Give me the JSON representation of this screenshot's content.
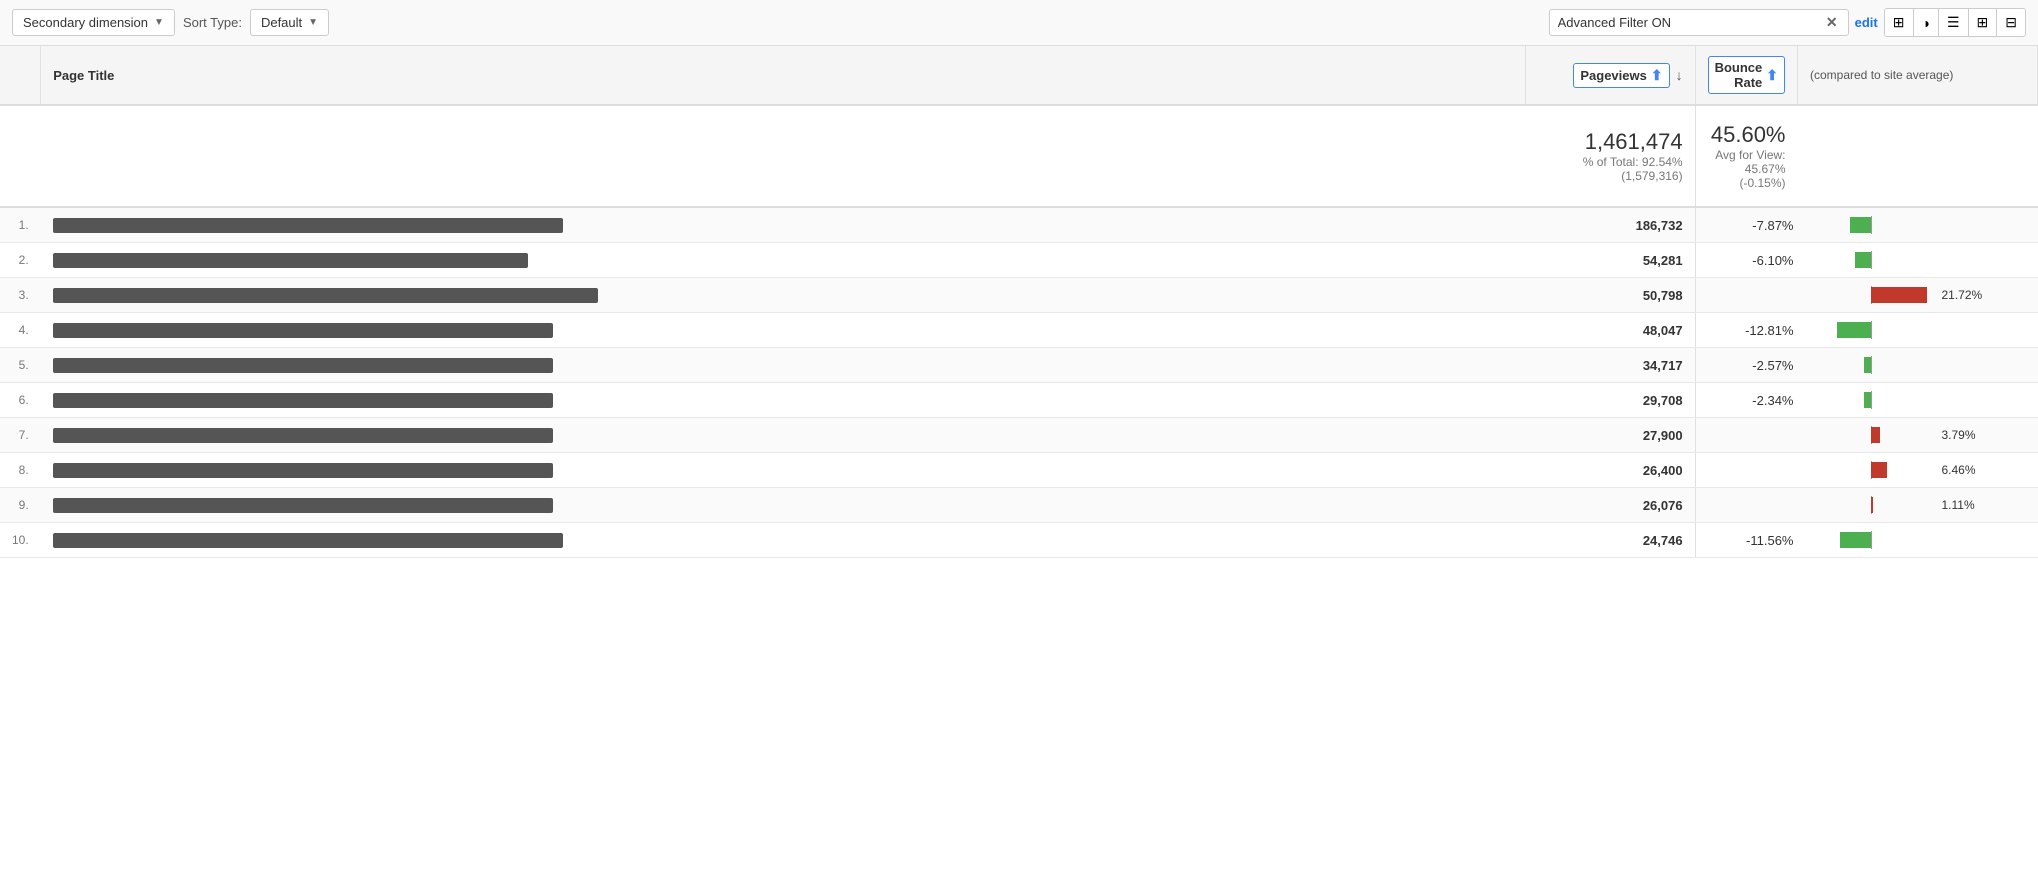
{
  "toolbar": {
    "secondary_dimension_label": "Secondary dimension",
    "sort_type_label": "Sort Type:",
    "sort_default": "Default",
    "filter_value": "Advanced Filter ON",
    "edit_label": "edit"
  },
  "icons": {
    "grid": "⊞",
    "pie": "◑",
    "list": "☰",
    "settings": "⊞",
    "table_extra": "⊟"
  },
  "columns": {
    "page_title": "Page Title",
    "pageviews": "Pageviews",
    "bounce_rate": "Bounce Rate",
    "compare_label": "(compared to site average)"
  },
  "totals": {
    "pageviews": "1,461,474",
    "pageviews_pct": "% of Total: 92.54% (1,579,316)",
    "bounce_rate": "45.60%",
    "bounce_avg": "Avg for View: 45.67% (-0.15%)"
  },
  "rows": [
    {
      "num": "1.",
      "title_width": 510,
      "pageviews": "186,732",
      "bounce_pct": "-7.87%",
      "bounce_dir": "negative",
      "bounce_magnitude": 7.87,
      "bar_label": ""
    },
    {
      "num": "2.",
      "title_width": 475,
      "pageviews": "54,281",
      "bounce_pct": "-6.10%",
      "bounce_dir": "negative",
      "bounce_magnitude": 6.1,
      "bar_label": ""
    },
    {
      "num": "3.",
      "title_width": 545,
      "pageviews": "50,798",
      "bounce_pct": "",
      "bounce_dir": "positive",
      "bounce_magnitude": 21.72,
      "bar_label": "21.72%"
    },
    {
      "num": "4.",
      "title_width": 500,
      "pageviews": "48,047",
      "bounce_pct": "-12.81%",
      "bounce_dir": "negative",
      "bounce_magnitude": 12.81,
      "bar_label": ""
    },
    {
      "num": "5.",
      "title_width": 500,
      "pageviews": "34,717",
      "bounce_pct": "-2.57%",
      "bounce_dir": "negative",
      "bounce_magnitude": 2.57,
      "bar_label": ""
    },
    {
      "num": "6.",
      "title_width": 500,
      "pageviews": "29,708",
      "bounce_pct": "-2.34%",
      "bounce_dir": "negative",
      "bounce_magnitude": 2.34,
      "bar_label": ""
    },
    {
      "num": "7.",
      "title_width": 500,
      "pageviews": "27,900",
      "bounce_pct": "",
      "bounce_dir": "positive",
      "bounce_magnitude": 3.79,
      "bar_label": "3.79%"
    },
    {
      "num": "8.",
      "title_width": 500,
      "pageviews": "26,400",
      "bounce_pct": "",
      "bounce_dir": "positive",
      "bounce_magnitude": 6.46,
      "bar_label": "6.46%"
    },
    {
      "num": "9.",
      "title_width": 500,
      "pageviews": "26,076",
      "bounce_pct": "",
      "bounce_dir": "positive",
      "bounce_magnitude": 1.11,
      "bar_label": "1.11%"
    },
    {
      "num": "10.",
      "title_width": 510,
      "pageviews": "24,746",
      "bounce_pct": "-11.56%",
      "bounce_dir": "negative",
      "bounce_magnitude": 11.56,
      "bar_label": ""
    }
  ]
}
